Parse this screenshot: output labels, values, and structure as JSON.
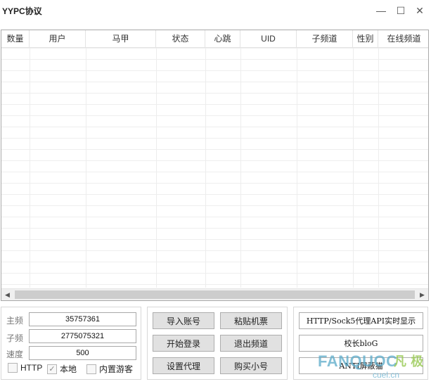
{
  "window": {
    "title": "YYPC协议",
    "minimize_glyph": "—",
    "maximize_glyph": "☐",
    "close_glyph": "✕"
  },
  "grid": {
    "columns": [
      "数量",
      "用户",
      "马甲",
      "状态",
      "心跳",
      "UID",
      "子频道",
      "性别",
      "在线频道"
    ],
    "rows": [],
    "scroll_left_glyph": "◀",
    "scroll_right_glyph": "▶"
  },
  "settings": {
    "main_channel": {
      "label": "主频",
      "value": "35757361"
    },
    "sub_channel": {
      "label": "子频",
      "value": "2775075321"
    },
    "speed": {
      "label": "速度",
      "value": "500"
    },
    "http": {
      "label": "HTTP",
      "checked": false
    },
    "local": {
      "label": "本地",
      "checked": true
    },
    "guest": {
      "label": "内置游客",
      "checked": false
    }
  },
  "actions": {
    "import_accounts": "导入账号",
    "paste_ticket": "粘贴机票",
    "start_login": "开始登录",
    "exit_channel": "退出频道",
    "set_proxy": "设置代理",
    "buy_accounts": "购买小号"
  },
  "links": {
    "proxy_api": "HTTP/Sock5代理API实时显示",
    "principal_blog": "校长bloG",
    "third_button": "ANTI屏蔽猫"
  },
  "watermark": {
    "brand": "FANQUOC",
    "domain": "cuel.cn",
    "cn": "凡 极"
  },
  "colors": {
    "grid_border": "#a9a9a9",
    "button_bg": "#e1e1e1",
    "scroll_thumb": "#cdcdcd"
  }
}
